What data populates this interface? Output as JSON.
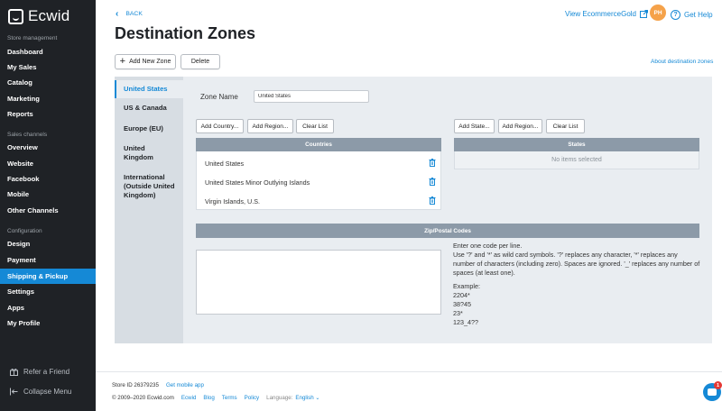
{
  "app": {
    "name": "Ecwid"
  },
  "sidebar": {
    "sections": [
      {
        "label": "Store management"
      },
      {
        "label": "Sales channels"
      },
      {
        "label": "Configuration"
      }
    ],
    "items": [
      {
        "label": "Dashboard"
      },
      {
        "label": "My Sales"
      },
      {
        "label": "Catalog"
      },
      {
        "label": "Marketing"
      },
      {
        "label": "Reports"
      },
      {
        "label": "Overview"
      },
      {
        "label": "Website"
      },
      {
        "label": "Facebook"
      },
      {
        "label": "Mobile"
      },
      {
        "label": "Other Channels"
      },
      {
        "label": "Design"
      },
      {
        "label": "Payment"
      },
      {
        "label": "Shipping & Pickup",
        "active": true
      },
      {
        "label": "Settings"
      },
      {
        "label": "Apps"
      },
      {
        "label": "My Profile"
      }
    ],
    "refer": "Refer a Friend",
    "collapse": "Collapse Menu"
  },
  "header": {
    "back": "BACK",
    "title": "Destination Zones",
    "view_store": "View EcommerceGold",
    "avatar_initials": "PH",
    "get_help": "Get Help"
  },
  "toolbar": {
    "add_zone": "Add New Zone",
    "delete": "Delete",
    "about": "About destination zones"
  },
  "zones": [
    {
      "label": "United States",
      "active": true
    },
    {
      "label": "US & Canada"
    },
    {
      "label": "Europe (EU)"
    },
    {
      "label": "United Kingdom"
    },
    {
      "label": "International (Outside United Kingdom)"
    }
  ],
  "zone_form": {
    "name_label": "Zone Name",
    "name_value": "United States",
    "add_country": "Add Country...",
    "add_region": "Add Region...",
    "clear_list": "Clear List",
    "add_state": "Add State...",
    "add_region_states": "Add Region...",
    "clear_list_states": "Clear List",
    "countries_header": "Countries",
    "countries": [
      "United States",
      "United States Minor Outlying Islands",
      "Virgin Islands, U.S."
    ],
    "states_header": "States",
    "states_empty": "No items selected",
    "zip_header": "Zip/Postal Codes",
    "zip_help_1": "Enter one code per line.",
    "zip_help_2": "Use '?' and '*' as wild card symbols. '?' replaces any character, '*' replaces any number of characters (including zero). Spaces are ignored. '_' replaces any number of spaces (at least one).",
    "example_label": "Example:",
    "examples": [
      "2204*",
      "38?45",
      "23*",
      "123_4??"
    ]
  },
  "footer": {
    "store_id": "Store ID 26379235",
    "mobile_app": "Get mobile app",
    "copyright": "© 2009–2020 Ecwid.com",
    "links": [
      "Ecwid",
      "Blog",
      "Terms",
      "Policy"
    ],
    "language_label": "Language:",
    "language_value": "English ⌄"
  },
  "chat": {
    "badge": "1"
  },
  "colors": {
    "accent": "#1589d6",
    "sidebar_bg": "#1f2226",
    "header_gray": "#8c9aa8"
  }
}
